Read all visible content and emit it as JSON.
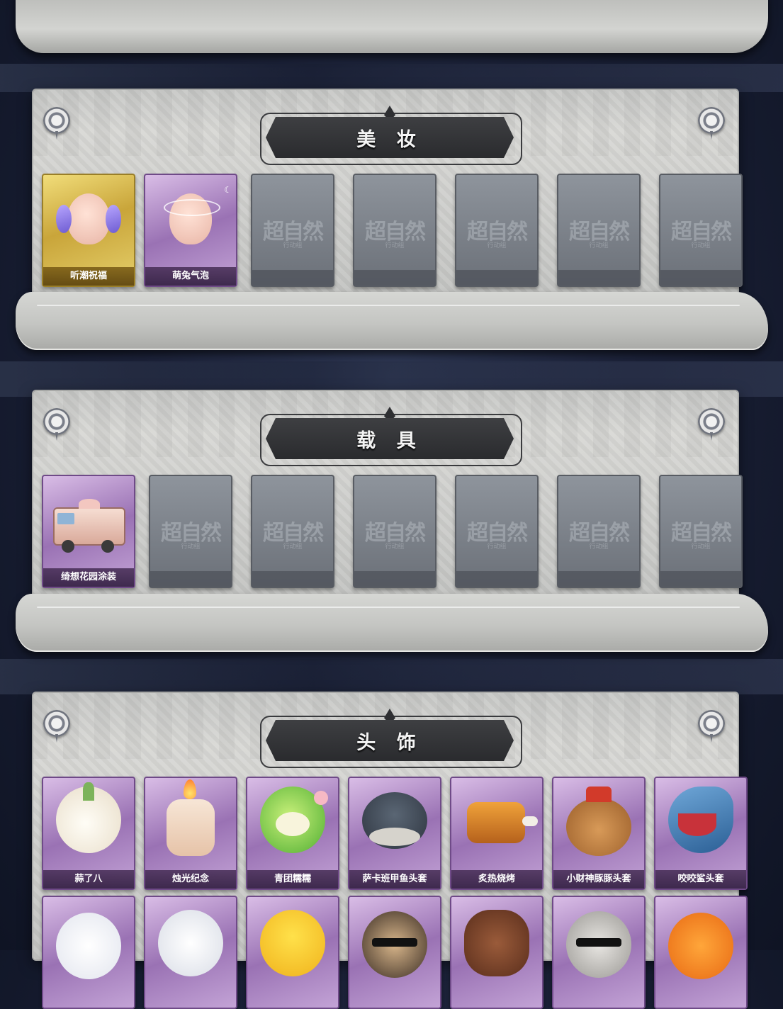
{
  "sections": {
    "makeup": {
      "title": "美 妆",
      "items": [
        {
          "label": "听潮祝福",
          "rarity": "gold",
          "icon": "mannequin-head-wings-icon"
        },
        {
          "label": "萌兔气泡",
          "rarity": "purple",
          "icon": "mannequin-head-bubble-icon"
        }
      ],
      "empty_slots": 5
    },
    "vehicle": {
      "title": "载 具",
      "items": [
        {
          "label": "绮想花园涂装",
          "rarity": "purple",
          "icon": "truck-icon"
        }
      ],
      "empty_slots": 6
    },
    "headwear": {
      "title": "头 饰",
      "items": [
        {
          "label": "蒜了八",
          "rarity": "purple",
          "icon": "garlic-icon"
        },
        {
          "label": "烛光纪念",
          "rarity": "purple",
          "icon": "candle-icon"
        },
        {
          "label": "青团糯糯",
          "rarity": "purple",
          "icon": "green-dumpling-icon"
        },
        {
          "label": "萨卡班甲鱼头套",
          "rarity": "purple",
          "icon": "fish-icon"
        },
        {
          "label": "炙热烧烤",
          "rarity": "purple",
          "icon": "bbq-meat-icon"
        },
        {
          "label": "小财神豚豚头套",
          "rarity": "purple",
          "icon": "capybara-icon"
        },
        {
          "label": "咬咬鲨头套",
          "rarity": "purple",
          "icon": "shark-icon"
        }
      ],
      "second_row_icons": [
        "ghost-icon",
        "cloud-icon",
        "emoji-face-icon",
        "dog-sunglasses-icon",
        "horse-icon",
        "raccoon-sunglasses-icon",
        "pumpkin-icon"
      ]
    }
  },
  "placeholder_logo": {
    "main": "超自然",
    "sub": "行动组"
  },
  "colors": {
    "gold": "#c9a53a",
    "purple": "#9a72b4",
    "empty": "#7b8088",
    "banner": "#2f3033",
    "parchment": "#cfd0cd"
  }
}
